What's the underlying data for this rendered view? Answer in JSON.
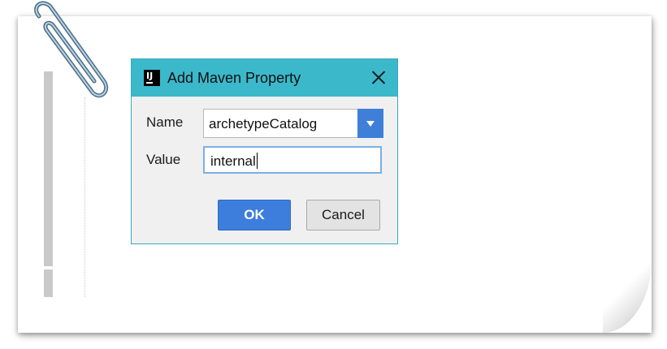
{
  "dialog": {
    "title": "Add Maven Property",
    "app_icon_text": "IJ",
    "name_label": "Name",
    "name_value": "archetypeCatalog",
    "value_label": "Value",
    "value_value": "internal",
    "ok_label": "OK",
    "cancel_label": "Cancel"
  },
  "colors": {
    "titlebar": "#3cb8cb",
    "primary_button": "#3d7ddb",
    "dropdown_arrow": "#3f7fd8"
  },
  "icons": {
    "app": "intellij-icon",
    "close": "close-icon",
    "dropdown": "chevron-down-icon",
    "decoration": "paperclip-icon"
  }
}
